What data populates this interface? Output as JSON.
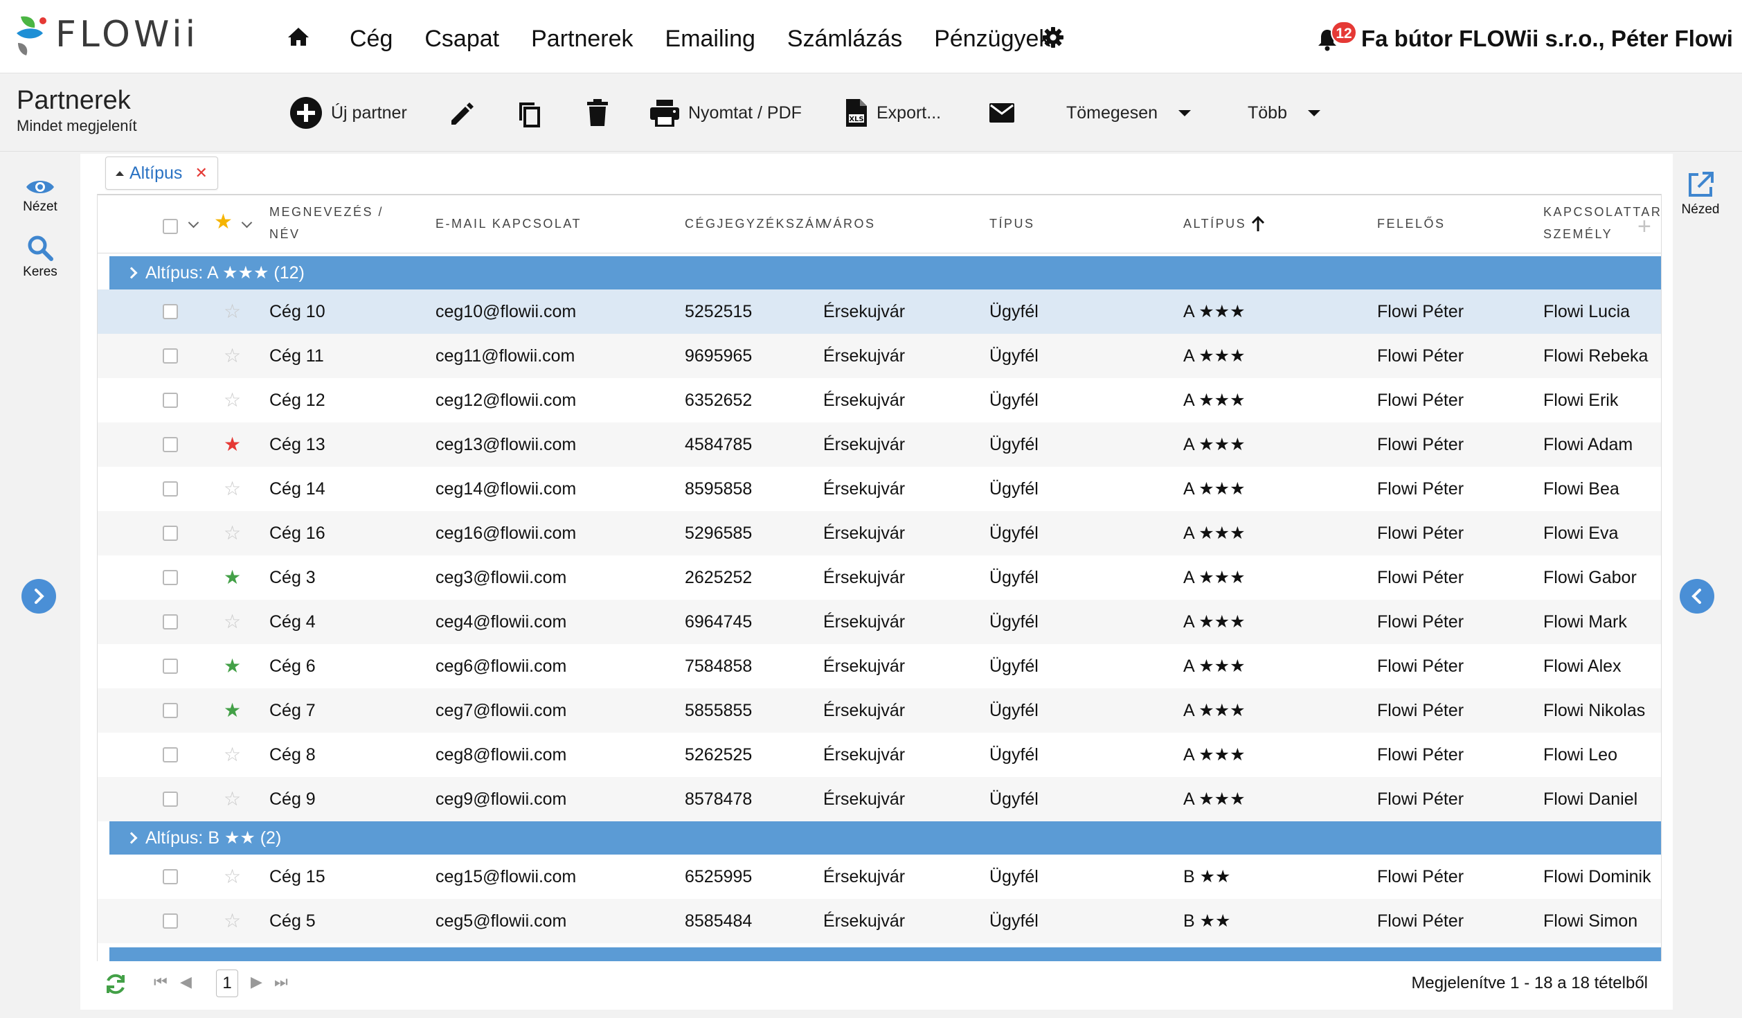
{
  "brand": {
    "name": "FLOWii",
    "accent": "#5b9bd5",
    "logo_colors": [
      "#1e8fd5",
      "#4bb543",
      "#e53935",
      "#7d7d7d"
    ]
  },
  "nav": {
    "items": [
      "Cég",
      "Csapat",
      "Partnerek",
      "Emailing",
      "Számlázás",
      "Pénzügyek"
    ],
    "notification_count": "12",
    "company_user": "Fa bútor FLOWii s.r.o., Péter Flowi"
  },
  "toolbar": {
    "title": "Partnerek",
    "subtitle": "Mindet megjelenít",
    "new_partner": "Új partner",
    "print_pdf": "Nyomtat / PDF",
    "export": "Export...",
    "bulk": "Tömegesen",
    "more": "Több"
  },
  "left_rail": {
    "view": "Nézet",
    "search": "Keres"
  },
  "right_rail": {
    "open": "Nézed"
  },
  "filter_chip": {
    "label": "Altípus"
  },
  "columns": {
    "name": [
      "Megnevezés /",
      "Név"
    ],
    "email": "E-mail kapcsolat",
    "reg": "Cégjegyzékszám",
    "city": "Város",
    "type": "Típus",
    "subtype": "Altípus",
    "owner": "Felelős",
    "contact": [
      "Kapcsolattart",
      "személy"
    ]
  },
  "groups": [
    {
      "label": "Altípus: A ★★★ (12)",
      "rows": [
        {
          "star": "empty",
          "name": "Cég 10",
          "email": "ceg10@flowii.com",
          "reg": "5252515",
          "city": "Érsekujvár",
          "type": "Ügyfél",
          "subtype": "A ★★★",
          "owner": "Flowi Péter",
          "contact": "Flowi Lucia"
        },
        {
          "star": "empty",
          "name": "Cég 11",
          "email": "ceg11@flowii.com",
          "reg": "9695965",
          "city": "Érsekujvár",
          "type": "Ügyfél",
          "subtype": "A ★★★",
          "owner": "Flowi Péter",
          "contact": "Flowi Rebeka"
        },
        {
          "star": "empty",
          "name": "Cég 12",
          "email": "ceg12@flowii.com",
          "reg": "6352652",
          "city": "Érsekujvár",
          "type": "Ügyfél",
          "subtype": "A ★★★",
          "owner": "Flowi Péter",
          "contact": "Flowi Erik"
        },
        {
          "star": "red",
          "name": "Cég 13",
          "email": "ceg13@flowii.com",
          "reg": "4584785",
          "city": "Érsekujvár",
          "type": "Ügyfél",
          "subtype": "A ★★★",
          "owner": "Flowi Péter",
          "contact": "Flowi Adam"
        },
        {
          "star": "empty",
          "name": "Cég 14",
          "email": "ceg14@flowii.com",
          "reg": "8595858",
          "city": "Érsekujvár",
          "type": "Ügyfél",
          "subtype": "A ★★★",
          "owner": "Flowi Péter",
          "contact": "Flowi Bea"
        },
        {
          "star": "empty",
          "name": "Cég 16",
          "email": "ceg16@flowii.com",
          "reg": "5296585",
          "city": "Érsekujvár",
          "type": "Ügyfél",
          "subtype": "A ★★★",
          "owner": "Flowi Péter",
          "contact": "Flowi Eva"
        },
        {
          "star": "green",
          "name": "Cég 3",
          "email": "ceg3@flowii.com",
          "reg": "2625252",
          "city": "Érsekujvár",
          "type": "Ügyfél",
          "subtype": "A ★★★",
          "owner": "Flowi Péter",
          "contact": "Flowi Gabor"
        },
        {
          "star": "empty",
          "name": "Cég 4",
          "email": "ceg4@flowii.com",
          "reg": "6964745",
          "city": "Érsekujvár",
          "type": "Ügyfél",
          "subtype": "A ★★★",
          "owner": "Flowi Péter",
          "contact": "Flowi Mark"
        },
        {
          "star": "green",
          "name": "Cég 6",
          "email": "ceg6@flowii.com",
          "reg": "7584858",
          "city": "Érsekujvár",
          "type": "Ügyfél",
          "subtype": "A ★★★",
          "owner": "Flowi Péter",
          "contact": "Flowi Alex"
        },
        {
          "star": "green",
          "name": "Cég 7",
          "email": "ceg7@flowii.com",
          "reg": "5855855",
          "city": "Érsekujvár",
          "type": "Ügyfél",
          "subtype": "A ★★★",
          "owner": "Flowi Péter",
          "contact": "Flowi Nikolas"
        },
        {
          "star": "empty",
          "name": "Cég 8",
          "email": "ceg8@flowii.com",
          "reg": "5262525",
          "city": "Érsekujvár",
          "type": "Ügyfél",
          "subtype": "A ★★★",
          "owner": "Flowi Péter",
          "contact": "Flowi Leo"
        },
        {
          "star": "empty",
          "name": "Cég 9",
          "email": "ceg9@flowii.com",
          "reg": "8578478",
          "city": "Érsekujvár",
          "type": "Ügyfél",
          "subtype": "A ★★★",
          "owner": "Flowi Péter",
          "contact": "Flowi Daniel"
        }
      ]
    },
    {
      "label": "Altípus: B ★★ (2)",
      "rows": [
        {
          "star": "empty",
          "name": "Cég 15",
          "email": "ceg15@flowii.com",
          "reg": "6525995",
          "city": "Érsekujvár",
          "type": "Ügyfél",
          "subtype": "B ★★",
          "owner": "Flowi Péter",
          "contact": "Flowi Dominik"
        },
        {
          "star": "empty",
          "name": "Cég 5",
          "email": "ceg5@flowii.com",
          "reg": "8585484",
          "city": "Érsekujvár",
          "type": "Ügyfél",
          "subtype": "B ★★",
          "owner": "Flowi Péter",
          "contact": "Flowi Simon"
        }
      ]
    }
  ],
  "footer": {
    "page": "1",
    "summary": "Megjelenítve 1 - 18 a 18 tételből"
  },
  "star_colors": {
    "empty": "#c8c8c8",
    "red": "#e53935",
    "green": "#43a047",
    "header": "#f5b400"
  }
}
